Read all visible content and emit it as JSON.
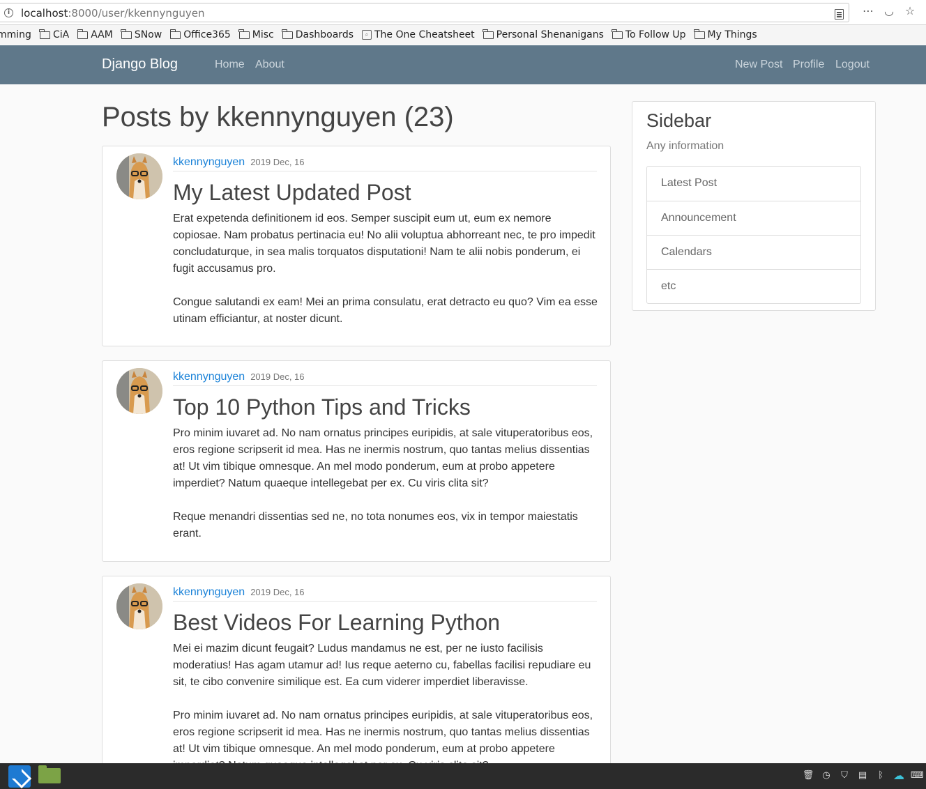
{
  "browser": {
    "url_host": "localhost",
    "url_path": ":8000/user/kkennynguyen",
    "bookmarks": [
      {
        "label": "mming",
        "icon": "folder-icon"
      },
      {
        "label": "CiA",
        "icon": "folder-icon"
      },
      {
        "label": "AAM",
        "icon": "folder-icon"
      },
      {
        "label": "SNow",
        "icon": "folder-icon"
      },
      {
        "label": "Office365",
        "icon": "folder-icon"
      },
      {
        "label": "Misc",
        "icon": "folder-icon"
      },
      {
        "label": "Dashboards",
        "icon": "folder-icon"
      },
      {
        "label": "The One Cheatsheet",
        "icon": "page-icon"
      },
      {
        "label": "Personal Shenanigans",
        "icon": "folder-icon"
      },
      {
        "label": "To Follow Up",
        "icon": "folder-icon"
      },
      {
        "label": "My Things",
        "icon": "folder-icon"
      }
    ]
  },
  "navbar": {
    "brand": "Django Blog",
    "left_links": [
      "Home",
      "About"
    ],
    "right_links": [
      "New Post",
      "Profile",
      "Logout"
    ]
  },
  "main": {
    "heading": "Posts by kkennynguyen (23)",
    "posts": [
      {
        "author": "kkennynguyen",
        "date": "2019 Dec, 16",
        "title": "My Latest Updated Post",
        "paragraphs": [
          "Erat expetenda definitionem id eos. Semper suscipit eum ut, eum ex nemore copiosae. Nam probatus pertinacia eu! No alii voluptua abhorreant nec, te pro impedit concludaturque, in sea malis torquatos disputationi! Nam te alii nobis ponderum, ei fugit accusamus pro.",
          "Congue salutandi ex eam! Mei an prima consulatu, erat detracto eu quo? Vim ea esse utinam efficiantur, at noster dicunt."
        ]
      },
      {
        "author": "kkennynguyen",
        "date": "2019 Dec, 16",
        "title": "Top 10 Python Tips and Tricks",
        "paragraphs": [
          "Pro minim iuvaret ad. No nam ornatus principes euripidis, at sale vituperatoribus eos, eros regione scripserit id mea. Has ne inermis nostrum, quo tantas melius dissentias at! Ut vim tibique omnesque. An mel modo ponderum, eum at probo appetere imperdiet? Natum quaeque intellegebat per ex. Cu viris clita sit?",
          "Reque menandri dissentias sed ne, no tota nonumes eos, vix in tempor maiestatis erant."
        ]
      },
      {
        "author": "kkennynguyen",
        "date": "2019 Dec, 16",
        "title": "Best Videos For Learning Python",
        "paragraphs": [
          "Mei ei mazim dicunt feugait? Ludus mandamus ne est, per ne iusto facilisis moderatius! Has agam utamur ad! Ius reque aeterno cu, fabellas facilisi repudiare eu sit, te cibo convenire similique est. Ea cum viderer imperdiet liberavisse.",
          "Pro minim iuvaret ad. No nam ornatus principes euripidis, at sale vituperatoribus eos, eros regione scripserit id mea. Has ne inermis nostrum, quo tantas melius dissentias at! Ut vim tibique omnesque. An mel modo ponderum, eum at probo appetere imperdiet? Natum quaeque intellegebat per ex. Cu viris clita sit?"
        ]
      }
    ]
  },
  "sidebar": {
    "title": "Sidebar",
    "subtitle": "Any information",
    "items": [
      "Latest Post",
      "Announcement",
      "Calendars",
      "etc"
    ]
  },
  "taskbar": {
    "apps": [
      "vscode-icon",
      "files-icon"
    ],
    "tray": [
      "trash-icon",
      "clock-icon",
      "shield-icon",
      "inbox-icon",
      "bluetooth-icon",
      "cloud-icon",
      "keyboard-icon"
    ]
  },
  "colors": {
    "navbar": "#5f788a",
    "link": "#1a82d8",
    "background": "#fafafa"
  }
}
